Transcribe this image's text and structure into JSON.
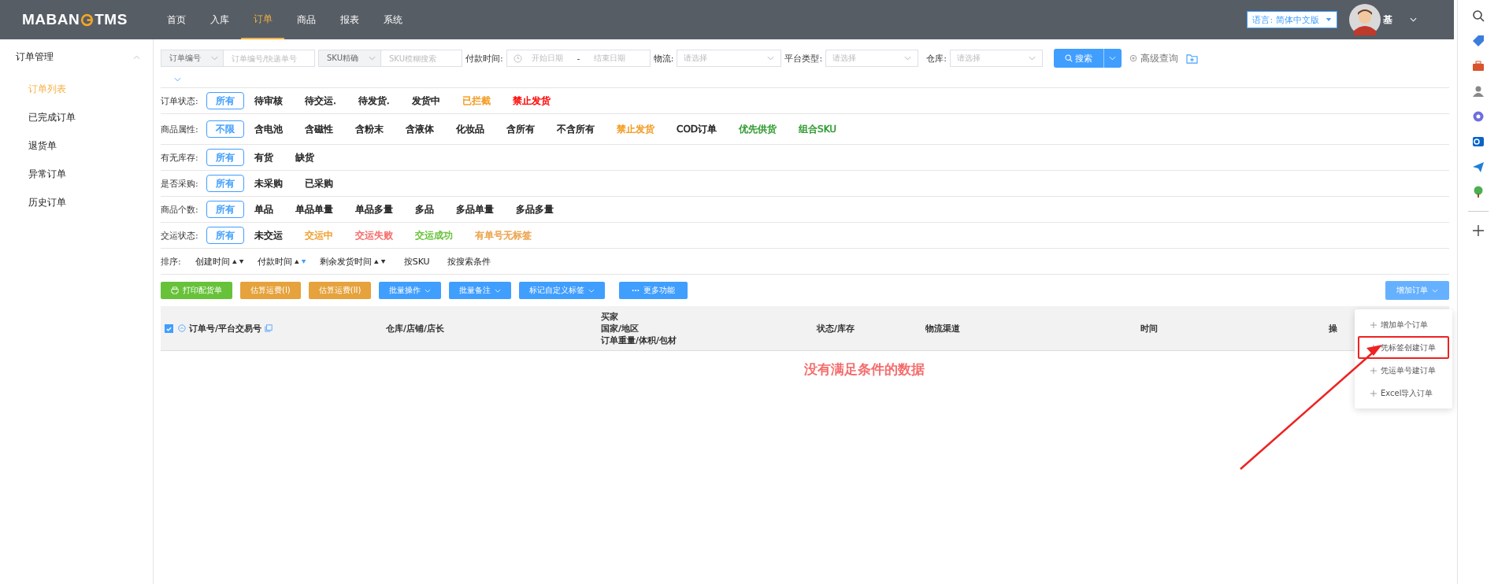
{
  "header": {
    "logo_left": "MABAN",
    "logo_right": "TMS",
    "nav": [
      {
        "label": "首页",
        "selected": false
      },
      {
        "label": "入库",
        "selected": false
      },
      {
        "label": "订单",
        "selected": true
      },
      {
        "label": "商品",
        "selected": false
      },
      {
        "label": "报表",
        "selected": false
      },
      {
        "label": "系统",
        "selected": false
      }
    ],
    "language": "语言: 简体中文版",
    "user": "基"
  },
  "sidebar": {
    "group": "订单管理",
    "expanded": true,
    "items": [
      {
        "label": "订单列表",
        "selected": true
      },
      {
        "label": "已完成订单",
        "selected": false
      },
      {
        "label": "退货单",
        "selected": false
      },
      {
        "label": "异常订单",
        "selected": false
      },
      {
        "label": "历史订单",
        "selected": false
      }
    ]
  },
  "search": {
    "order_select": "订单编号",
    "order_placeholder": "订单编号/快递单号",
    "sku_select": "SKU精确",
    "sku_placeholder": "SKU模糊搜索",
    "pay_label": "付款时间:",
    "date_start": "开始日期",
    "date_sep": "-",
    "date_end": "结束日期",
    "logistics_label": "物流:",
    "logistics_placeholder": "请选择",
    "platform_label": "平台类型:",
    "platform_placeholder": "请选择",
    "warehouse_label": "仓库:",
    "warehouse_placeholder": "请选择",
    "search_button": "搜索",
    "advanced": "高级查询"
  },
  "filters": [
    {
      "label": "订单状态:",
      "options": [
        {
          "text": "所有",
          "selected": true
        },
        {
          "text": "待审核",
          "selected": false
        },
        {
          "text": "待交运.",
          "selected": false
        },
        {
          "text": "待发货.",
          "selected": false
        },
        {
          "text": "发货中",
          "selected": false
        },
        {
          "text": "已拦截",
          "selected": false,
          "color": "#f39a1e"
        },
        {
          "text": "禁止发货",
          "selected": false,
          "color": "#ff0000"
        }
      ]
    },
    {
      "label": "商品属性:",
      "options": [
        {
          "text": "不限",
          "selected": true
        },
        {
          "text": "含电池",
          "selected": false
        },
        {
          "text": "含磁性",
          "selected": false
        },
        {
          "text": "含粉末",
          "selected": false
        },
        {
          "text": "含液体",
          "selected": false
        },
        {
          "text": "化妆品",
          "selected": false
        },
        {
          "text": "含所有",
          "selected": false
        },
        {
          "text": "不含所有",
          "selected": false
        },
        {
          "text": "禁止发货",
          "selected": false,
          "color": "#f39a1e"
        },
        {
          "text": "COD订单",
          "selected": false
        },
        {
          "text": "优先供货",
          "selected": false,
          "color": "#2f9a2f"
        },
        {
          "text": "组合SKU",
          "selected": false,
          "color": "#2f9a2f"
        }
      ]
    },
    {
      "label": "有无库存:",
      "options": [
        {
          "text": "所有",
          "selected": true
        },
        {
          "text": "有货",
          "selected": false
        },
        {
          "text": "缺货",
          "selected": false
        }
      ]
    },
    {
      "label": "是否采购:",
      "options": [
        {
          "text": "所有",
          "selected": true
        },
        {
          "text": "未采购",
          "selected": false
        },
        {
          "text": "已采购",
          "selected": false
        }
      ]
    },
    {
      "label": "商品个数:",
      "options": [
        {
          "text": "所有",
          "selected": true
        },
        {
          "text": "单品",
          "selected": false
        },
        {
          "text": "单品单量",
          "selected": false
        },
        {
          "text": "单品多量",
          "selected": false
        },
        {
          "text": "多品",
          "selected": false
        },
        {
          "text": "多品单量",
          "selected": false
        },
        {
          "text": "多品多量",
          "selected": false
        }
      ]
    },
    {
      "label": "交运状态:",
      "options": [
        {
          "text": "所有",
          "selected": true
        },
        {
          "text": "未交运",
          "selected": false
        },
        {
          "text": "交运中",
          "selected": false,
          "color": "#f0a030"
        },
        {
          "text": "交运失败",
          "selected": false,
          "color": "#f56c6c"
        },
        {
          "text": "交运成功",
          "selected": false,
          "color": "#67c23a"
        },
        {
          "text": "有单号无标签",
          "selected": false,
          "color": "#eca24a"
        }
      ]
    }
  ],
  "sort": {
    "label": "排序:",
    "items": [
      {
        "text": "创建时间",
        "kind": "sortable",
        "selected": false
      },
      {
        "text": "付款时间",
        "kind": "sortable",
        "selected": true
      },
      {
        "text": "剩余发货时间",
        "kind": "sortable",
        "selected": false
      },
      {
        "text": "按SKU",
        "kind": "plain"
      },
      {
        "text": "按搜索条件",
        "kind": "plain"
      }
    ]
  },
  "actions": [
    {
      "label": "打印配货单",
      "kind": "print"
    },
    {
      "label": "估算运费(I)",
      "kind": "estimate"
    },
    {
      "label": "估算运费(II)",
      "kind": "estimate"
    },
    {
      "label": "批量操作",
      "kind": "menu"
    },
    {
      "label": "批量备注",
      "kind": "menu"
    },
    {
      "label": "标记自定义标签",
      "kind": "menu"
    },
    {
      "label": "更多功能",
      "kind": "more"
    }
  ],
  "add_order": {
    "label": "增加订单",
    "expanded": true,
    "items": [
      {
        "label": "增加单个订单",
        "annotated": false
      },
      {
        "label": "凭标签创建订单",
        "annotated": true
      },
      {
        "label": "凭运单号建订单",
        "annotated": false
      },
      {
        "label": "Excel导入订单",
        "annotated": false
      }
    ]
  },
  "table": {
    "select_all": true,
    "columns": [
      {
        "lines": [
          "订单号/平台交易号"
        ]
      },
      {
        "lines": [
          "仓库/店铺/店长"
        ]
      },
      {
        "lines": [
          "买家",
          "国家/地区",
          "订单重量/体积/包材"
        ]
      },
      {
        "lines": [
          "状态/库存"
        ]
      },
      {
        "lines": [
          "物流渠道"
        ]
      },
      {
        "lines": [
          "时间"
        ]
      },
      {
        "lines": [
          "操"
        ]
      }
    ],
    "empty_text": "没有满足条件的数据"
  }
}
